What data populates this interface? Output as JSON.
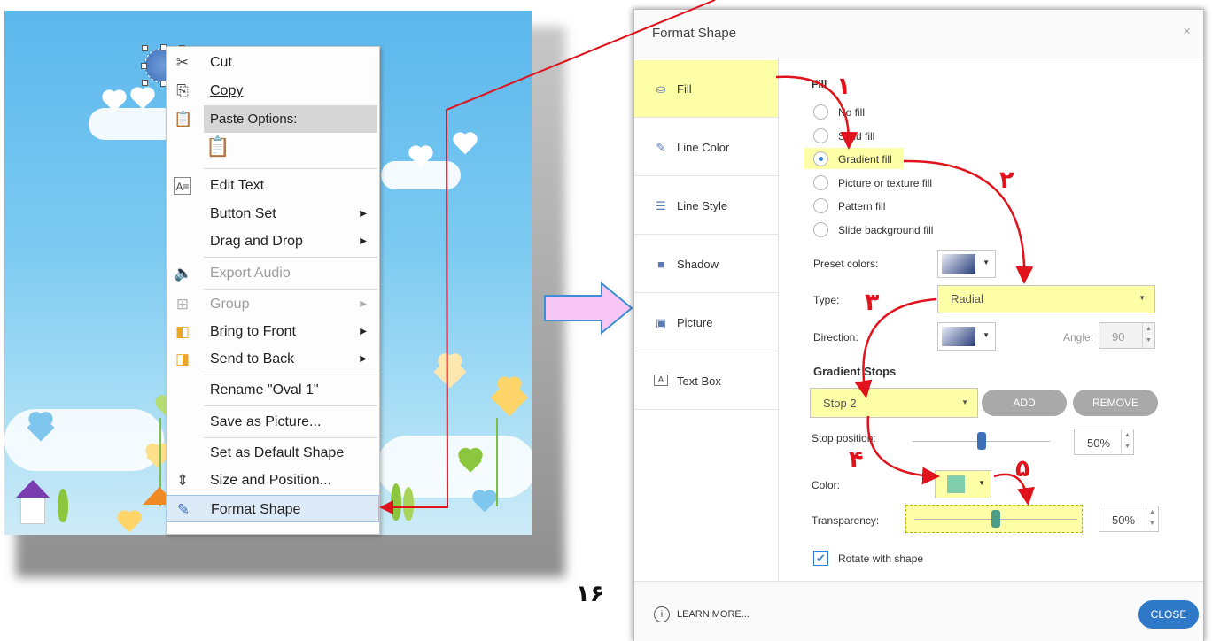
{
  "left_screenshot": {
    "context_menu": {
      "items": [
        {
          "label": "Cut",
          "icon": "scissors-icon"
        },
        {
          "label": "Copy",
          "icon": "copy-icon"
        },
        {
          "label": "Paste Options:",
          "icon": "paste-icon"
        },
        {
          "label": "Edit Text",
          "icon": "edit-text-icon"
        },
        {
          "label": "Button Set",
          "icon": ""
        },
        {
          "label": "Drag and Drop",
          "icon": ""
        },
        {
          "label": "Export Audio",
          "icon": "export-audio-icon"
        },
        {
          "label": "Group",
          "icon": "group-icon"
        },
        {
          "label": "Bring to Front",
          "icon": "bring-front-icon"
        },
        {
          "label": "Send to Back",
          "icon": "send-back-icon"
        },
        {
          "label": "Rename \"Oval 1\"",
          "icon": ""
        },
        {
          "label": "Save as Picture...",
          "icon": ""
        },
        {
          "label": "Set as Default Shape",
          "icon": ""
        },
        {
          "label": "Size and Position...",
          "icon": "size-position-icon"
        },
        {
          "label": "Format Shape",
          "icon": "format-shape-icon"
        }
      ]
    }
  },
  "page_number": "۱۶",
  "dialog": {
    "title": "Format Shape",
    "close_icon": "×",
    "tabs": [
      {
        "label": "Fill",
        "icon": "paint-bucket-icon"
      },
      {
        "label": "Line Color",
        "icon": "pencil-icon"
      },
      {
        "label": "Line Style",
        "icon": "line-style-icon"
      },
      {
        "label": "Shadow",
        "icon": "shadow-icon"
      },
      {
        "label": "Picture",
        "icon": "picture-icon"
      },
      {
        "label": "Text Box",
        "icon": "text-box-icon"
      }
    ],
    "fill": {
      "heading": "Fill",
      "options": [
        "No fill",
        "Solid fill",
        "Gradient fill",
        "Picture or texture fill",
        "Pattern fill",
        "Slide background fill"
      ],
      "selected": "Gradient fill",
      "preset_colors_label": "Preset colors:",
      "type_label": "Type:",
      "type_value": "Radial",
      "direction_label": "Direction:",
      "angle_label": "Angle:",
      "angle_value": "90",
      "gradient_stops_label": "Gradient Stops",
      "stop_value": "Stop 2",
      "add_label": "ADD",
      "remove_label": "REMOVE",
      "stop_position_label": "Stop position:",
      "stop_position_value": "50%",
      "stop_position_fraction": 0.5,
      "color_label": "Color:",
      "stop_color": "#7fcfae",
      "transparency_label": "Transparency:",
      "transparency_value": "50%",
      "transparency_fraction": 0.5,
      "rotate_label": "Rotate with shape",
      "rotate_checked": true
    },
    "footer": {
      "learn_more": "LEARN MORE...",
      "close": "CLOSE"
    }
  },
  "annotations": {
    "step_numbers": [
      "۱",
      "۲",
      "۳",
      "۴",
      "۵"
    ],
    "arrow_color": "#e0121b",
    "highlight_color": "#ffffa8"
  }
}
